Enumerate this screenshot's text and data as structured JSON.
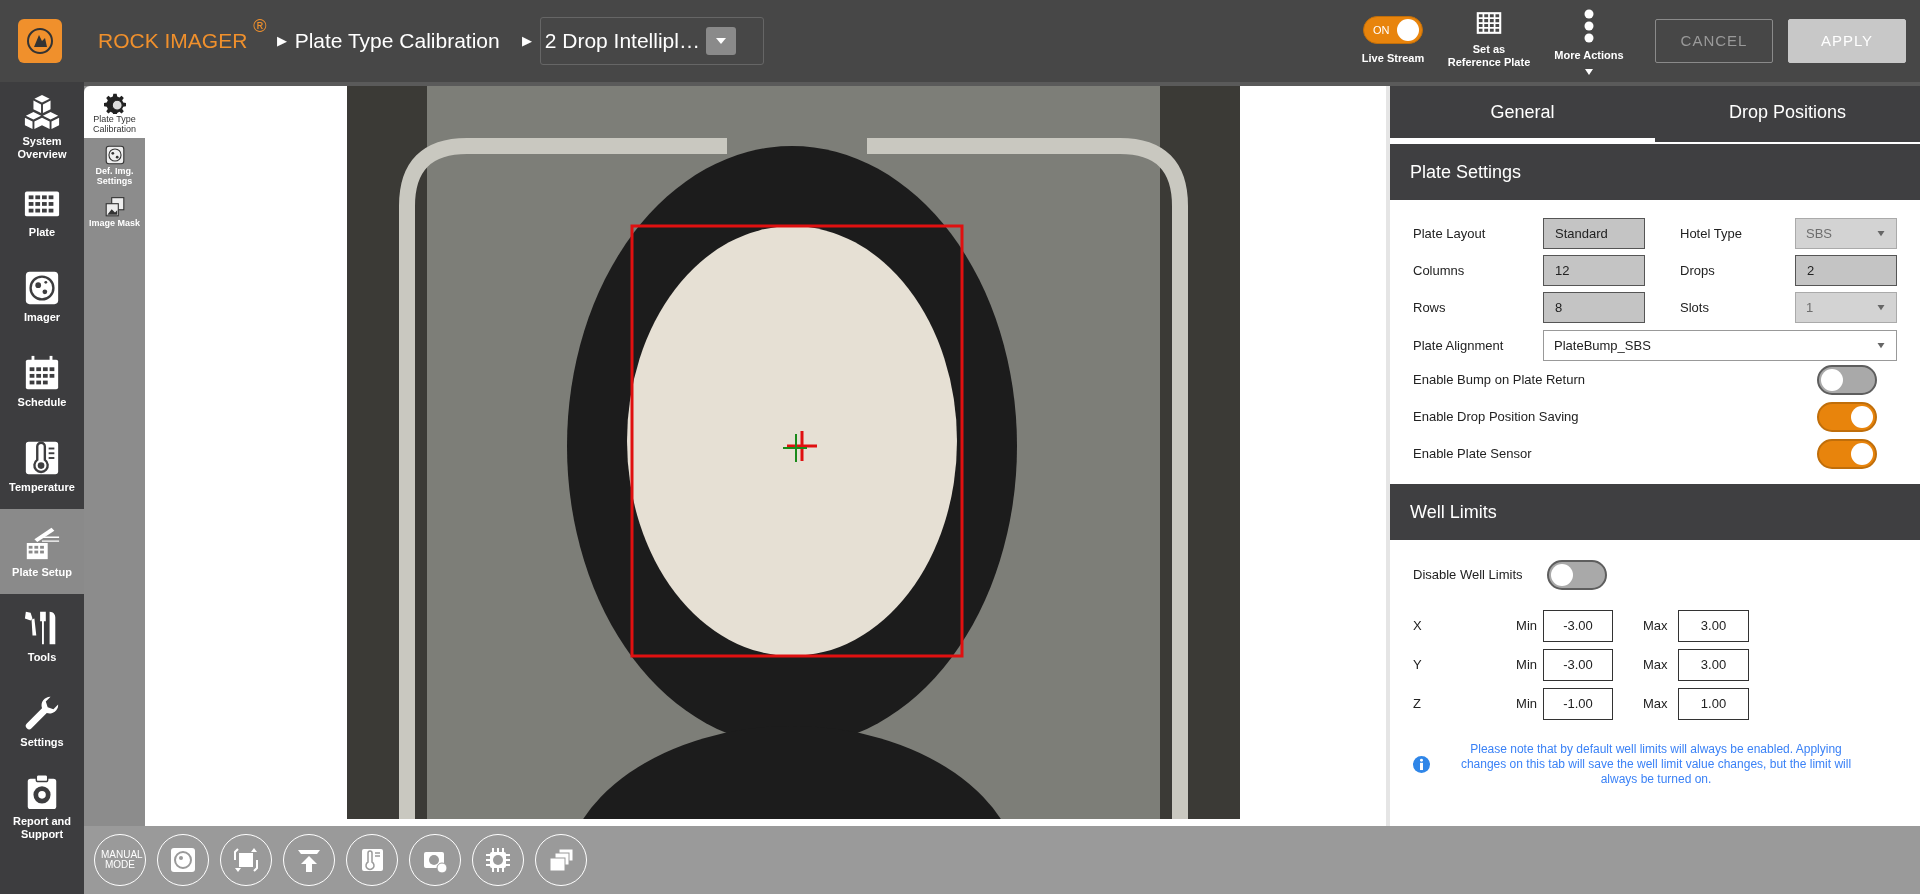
{
  "header": {
    "app_name": "ROCK IMAGER",
    "registered_mark": "®",
    "breadcrumb_separator": "▶",
    "breadcrumb": "Plate Type Calibration",
    "plate_select": {
      "value": "2 Drop Intellipl…"
    },
    "live_stream": {
      "toggle_text": "ON",
      "on": true,
      "label": "Live Stream"
    },
    "actions": [
      {
        "kind": "grid",
        "label": "Set as Reference Plate"
      },
      {
        "kind": "more",
        "label": "More Actions"
      }
    ],
    "buttons": [
      {
        "label": "CANCEL",
        "disabled": false
      },
      {
        "label": "APPLY",
        "disabled": true
      }
    ]
  },
  "sidebar": {
    "items": [
      {
        "kind": "overview",
        "label": "System Overview",
        "selected": false
      },
      {
        "kind": "plate",
        "label": "Plate",
        "selected": false
      },
      {
        "kind": "imager",
        "label": "Imager",
        "selected": false
      },
      {
        "kind": "schedule",
        "label": "Schedule",
        "selected": false
      },
      {
        "kind": "temperature",
        "label": "Temperature",
        "selected": false
      },
      {
        "kind": "setup",
        "label": "Plate Setup",
        "selected": true
      },
      {
        "kind": "tools",
        "label": "Tools",
        "selected": false
      },
      {
        "kind": "settings",
        "label": "Settings",
        "selected": false
      },
      {
        "kind": "report",
        "label": "Report and Support",
        "selected": false
      }
    ]
  },
  "subnav": {
    "items": [
      {
        "kind": "gear",
        "label": "Plate Type Calibration",
        "selected": true
      },
      {
        "kind": "dish",
        "label": "Def. Img. Settings",
        "selected": false
      },
      {
        "kind": "mask",
        "label": "Image Mask",
        "selected": false
      }
    ]
  },
  "toolbar": {
    "manual_mode": "MANUAL MODE"
  },
  "panel": {
    "tabs": [
      {
        "label": "General",
        "selected": true
      },
      {
        "label": "Drop Positions",
        "selected": false
      }
    ],
    "plate_settings": {
      "title": "Plate Settings",
      "fields": [
        {
          "label": "Plate Layout",
          "value": "Standard",
          "kind": "readonly"
        },
        {
          "label": "Hotel Type",
          "value": "SBS",
          "kind": "select",
          "disabled": true
        },
        {
          "label": "Columns",
          "value": "12",
          "kind": "readonly"
        },
        {
          "label": "Drops",
          "value": "2",
          "kind": "readonly"
        },
        {
          "label": "Rows",
          "value": "8",
          "kind": "readonly"
        },
        {
          "label": "Slots",
          "value": "1",
          "kind": "select",
          "disabled": true
        }
      ],
      "alignment": {
        "label": "Plate Alignment",
        "value": "PlateBump_SBS"
      },
      "toggles": [
        {
          "label": "Enable Bump on Plate Return",
          "on": false
        },
        {
          "label": "Enable Drop Position Saving",
          "on": true
        },
        {
          "label": "Enable Plate Sensor",
          "on": true
        }
      ]
    },
    "well_limits": {
      "title": "Well Limits",
      "disable_toggle": {
        "label": "Disable Well Limits",
        "on": false
      },
      "axes": [
        {
          "axis": "X",
          "min_label": "Min",
          "min": "-3.00",
          "max_label": "Max",
          "max": "3.00"
        },
        {
          "axis": "Y",
          "min_label": "Min",
          "min": "-3.00",
          "max_label": "Max",
          "max": "3.00"
        },
        {
          "axis": "Z",
          "min_label": "Min",
          "min": "-1.00",
          "max_label": "Max",
          "max": "1.00"
        }
      ],
      "note": "Please note that by default well limits will always be enabled. Applying changes on this tab will save the well limit value changes, but the limit will always be turned on."
    }
  }
}
